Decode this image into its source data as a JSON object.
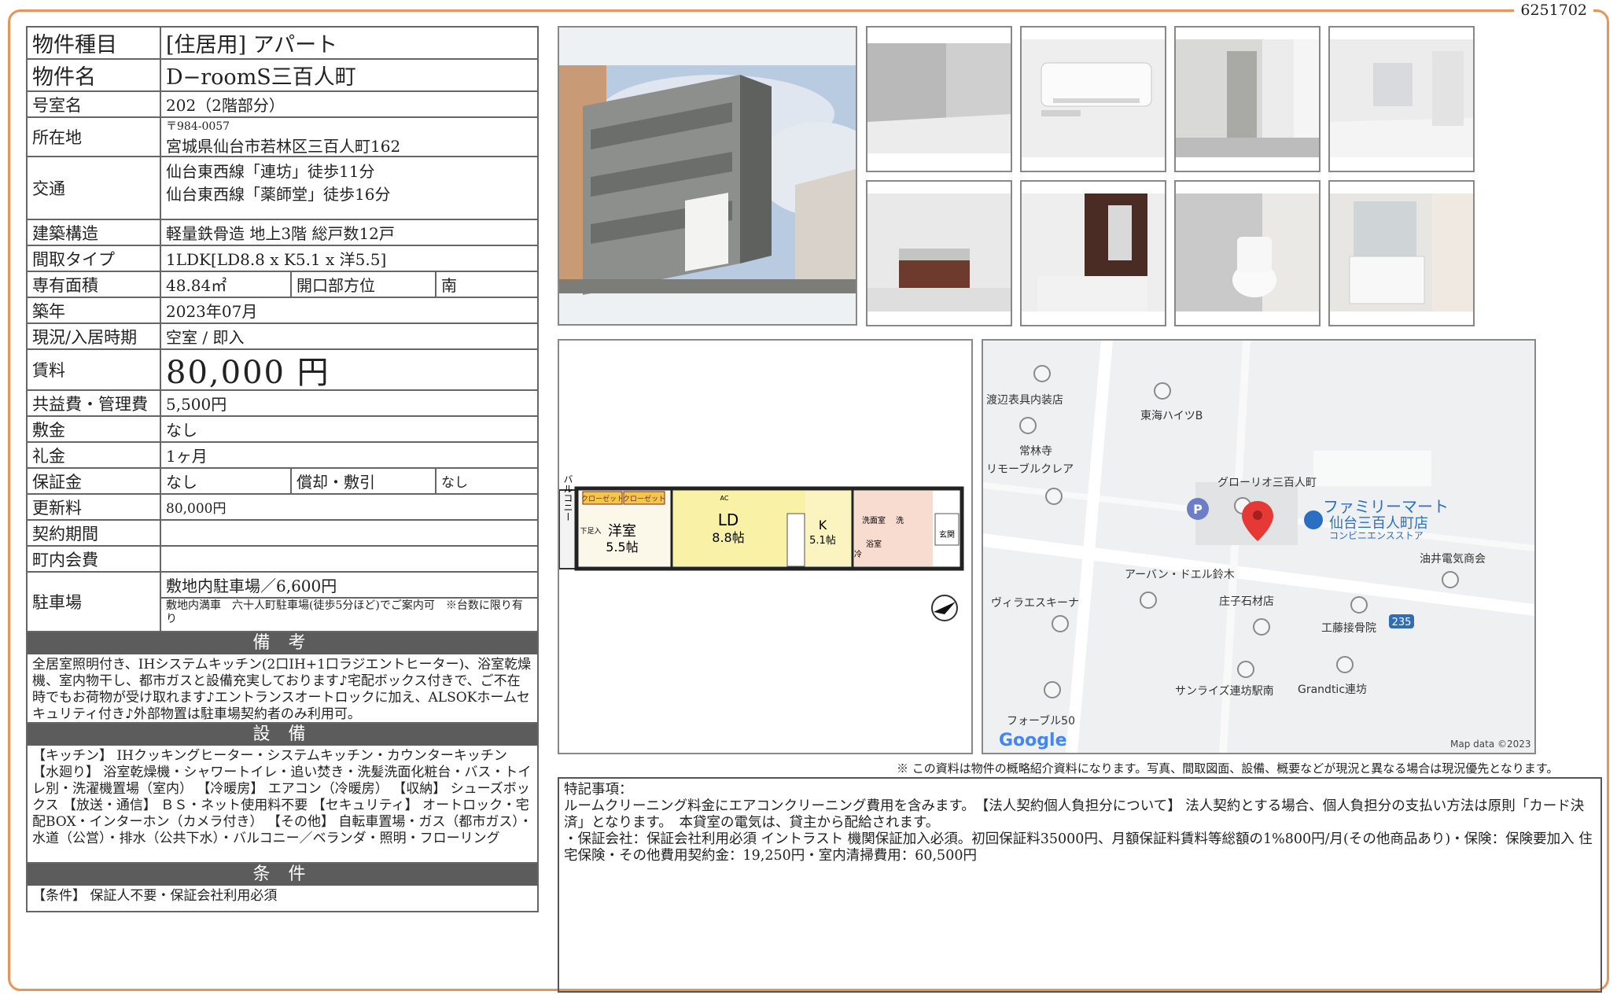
{
  "doc_number": "6251702",
  "info": {
    "type_label": "物件種目",
    "type_value": "[住居用] アパート",
    "name_label": "物件名",
    "name_value": "D−roomS三百人町",
    "room_label": "号室名",
    "room_value": "202（2階部分）",
    "address_label": "所在地",
    "postal": "〒984-0057",
    "address": "宮城県仙台市若林区三百人町162",
    "access_label": "交通",
    "access_1": "仙台東西線「連坊」徒歩11分",
    "access_2": "仙台東西線「薬師堂」徒歩16分",
    "structure_label": "建築構造",
    "structure_value": "軽量鉄骨造 地上3階 総戸数12戸",
    "layout_label": "間取タイプ",
    "layout_value": "1LDK[LD8.8 x K5.1 x 洋5.5]",
    "area_label": "専有面積",
    "area_value": "48.84㎡",
    "direction_label": "開口部方位",
    "direction_value": "南",
    "built_label": "築年",
    "built_value": "2023年07月",
    "status_label": "現況/入居時期",
    "status_value": "空室 / 即入",
    "rent_label": "賃料",
    "rent_value": "80,000 円",
    "fee_label": "共益費・管理費",
    "fee_value": "5,500円",
    "deposit_label": "敷金",
    "deposit_value": "なし",
    "keymoney_label": "礼金",
    "keymoney_value": "1ヶ月",
    "guarantee_label": "保証金",
    "guarantee_value": "なし",
    "amort_label": "償却・敷引",
    "amort_value": "なし",
    "renewal_label": "更新料",
    "renewal_value": "80,000円",
    "contract_label": "契約期間",
    "contract_value": "",
    "assoc_label": "町内会費",
    "assoc_value": "",
    "parking_label": "駐車場",
    "parking_value": "敷地内駐車場／6,600円",
    "parking_note": "敷地内満車　六十人町駐車場(徒歩5分ほど)でご案内可　※台数に限り有り"
  },
  "remarks": {
    "title": "備 考",
    "text": "全居室照明付き、IHシステムキッチン(2口IH+1口ラジエントヒーター)、浴室乾燥機、室内物干し、都市ガスと設備充実しております♪宅配ボックス付きで、ご不在時でもお荷物が受け取れます♪エントランスオートロックに加え、ALSOKホームセキュリティ付き♪外部物置は駐車場契約者のみ利用可。"
  },
  "equipment": {
    "title": "設 備",
    "text": "【キッチン】 IHクッキングヒーター・システムキッチン・カウンターキッチン 【水廻り】 浴室乾燥機・シャワートイレ・追い焚き・洗髪洗面化粧台・バス・トイレ別・洗濯機置場（室内） 【冷暖房】 エアコン（冷暖房） 【収納】 シューズボックス 【放送・通信】 ＢＳ・ネット使用料不要 【セキュリティ】 オートロック・宅配BOX・インターホン（カメラ付き） 【その他】 自転車置場・ガス（都市ガス）・水道（公営）・排水（公共下水）・バルコニー／ベランダ・照明・フローリング"
  },
  "conditions": {
    "title": "条 件",
    "text": "【条件】 保証人不要・保証会社利用必須"
  },
  "floorplan": {
    "balcony": "バルコニー",
    "closet1": "クローゼット",
    "closet2": "クローゼット",
    "western": "洋室",
    "western_size": "5.5帖",
    "ld": "LD",
    "ld_size": "8.8帖",
    "k": "K",
    "k_size": "5.1帖",
    "washroom": "洗面室",
    "bath": "浴室",
    "entrance": "玄関",
    "ac": "AC",
    "wash": "洗",
    "fridge": "冷",
    "storage": "下足入"
  },
  "map": {
    "labels": [
      "渡辺表具内装店",
      "東海ハイツB",
      "常林寺",
      "リモーブルクレア",
      "グローリオ三百人町",
      "ファミリーマート",
      "仙台三百人町店",
      "コンビニエンスストア",
      "油井電気商会",
      "アーバン・ドエル鈴木",
      "ヴィラエスキーナ",
      "庄子石材店",
      "工藤接骨院",
      "235",
      "サンライズ連坊駅南",
      "Grandtic連坊",
      "フォーブル50"
    ],
    "logo": "Google",
    "credit": "Map data ©2023"
  },
  "notice": "※ この資料は物件の概略紹介資料になります。写真、間取図面、設備、概要などが現況と異なる場合は現況優先となります。",
  "special": {
    "title": "特記事項：",
    "line1": "ルームクリーニング料金にエアコンクリーニング費用を含みます。　【法人契約個人負担分について】 法人契約とする場合、個人負担分の支払い方法は原則「カード決済」となります。　本貸室の電気は、貸主から配給されます。",
    "line2": "・保証会社：保証会社利用必須 イントラスト 機関保証加入必須。初回保証料35000円、月額保証料賃料等総額の1%800円/月(その他商品あり)・保険：保険要加入 住宅保険・その他費用契約金：19,250円・室内清掃費用：60,500円"
  }
}
